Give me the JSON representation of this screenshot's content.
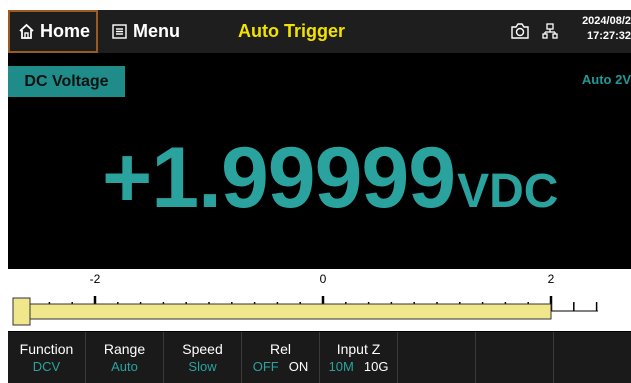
{
  "topbar": {
    "home_label": "Home",
    "menu_label": "Menu",
    "trigger_mode": "Auto Trigger",
    "date": "2024/08/2",
    "time": "17:27:32"
  },
  "measurement": {
    "function_label": "DC Voltage",
    "range_indicator": "Auto 2V",
    "value": "+1.99999",
    "unit": "VDC"
  },
  "bargraph": {
    "scale_labels": [
      "-2",
      "0",
      "2"
    ],
    "scale_min": -2,
    "scale_max": 2,
    "level": 1.99999
  },
  "softkeys": [
    {
      "label": "Function",
      "value": "DCV"
    },
    {
      "label": "Range",
      "value": "Auto"
    },
    {
      "label": "Speed",
      "value": "Slow"
    },
    {
      "label": "Rel",
      "options": [
        "OFF",
        "ON"
      ],
      "selected": "OFF"
    },
    {
      "label": "Input Z",
      "options": [
        "10M",
        "10G"
      ],
      "selected": "10M"
    },
    {
      "label": ""
    },
    {
      "label": ""
    },
    {
      "label": ""
    }
  ],
  "colors": {
    "accent": "#2aa39f",
    "trigger": "#f2e200",
    "bar_fill": "#f0e68c"
  }
}
